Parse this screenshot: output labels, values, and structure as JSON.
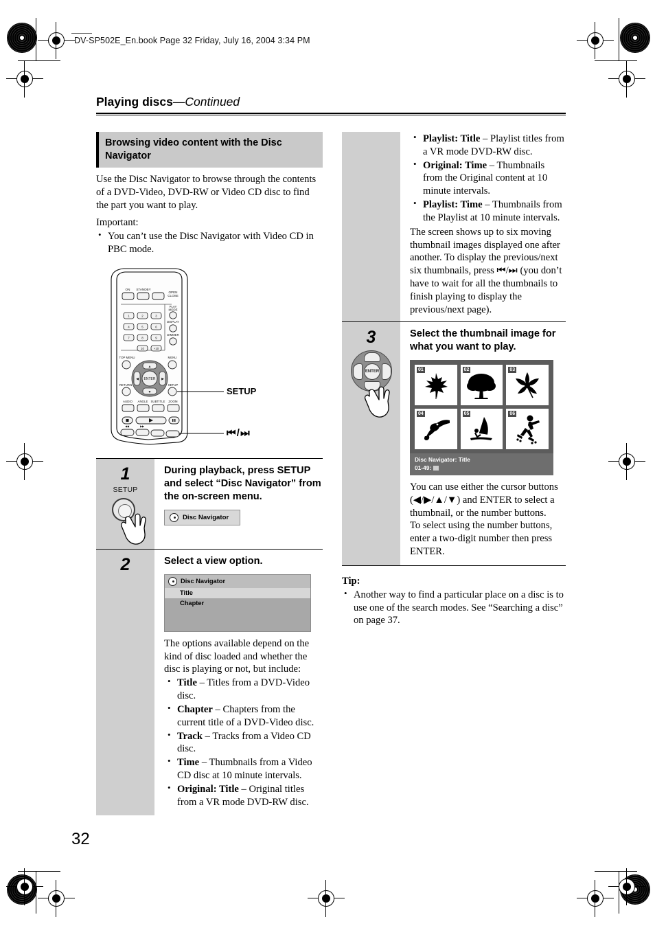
{
  "document": {
    "slug": "DV-SP502E_En.book  Page 32  Friday, July 16, 2004  3:34 PM",
    "running_head_main": "Playing discs",
    "running_head_cont": "—Continued",
    "page_number": "32"
  },
  "section": {
    "heading": "Browsing video content with the Disc Navigator",
    "intro": "Use the Disc Navigator to browse through the contents of a DVD-Video, DVD-RW or Video CD disc to find the part you want to play.",
    "important_label": "Important:",
    "important_bullets": [
      "You can’t use the Disc Navigator with Video CD in PBC mode."
    ]
  },
  "remote": {
    "callout_setup": "SETUP",
    "callout_skip": "⏮⏭",
    "buttons": {
      "on": "ON",
      "standby": "STANDBY",
      "open_close": "OPEN/CLOSE",
      "play_mode": "PLAY MODE",
      "display": "DISPLAY",
      "dimmer": "DIMMER",
      "top_menu": "TOP MENU",
      "menu": "MENU",
      "return": "RETURN",
      "setup": "SETUP",
      "audio": "AUDIO",
      "angle": "ANGLE",
      "subtitle": "SUBTITLE",
      "zoom": "ZOOM",
      "enter": "ENTER",
      "numbers": [
        "1",
        "2",
        "3",
        "4",
        "5",
        "6",
        "7",
        "8",
        "9",
        "10",
        "+10"
      ]
    }
  },
  "steps": [
    {
      "number": "1",
      "title": "During playback, press SETUP and select “Disc Navigator” from the on-screen menu.",
      "icon_label": "SETUP",
      "osd_chip": "Disc Navigator"
    },
    {
      "number": "2",
      "title": "Select a view option.",
      "panel": {
        "title": "Disc Navigator",
        "items": [
          {
            "label": "Title",
            "selected": true
          },
          {
            "label": "Chapter",
            "selected": false
          }
        ]
      },
      "body": "The options available depend on the kind of disc loaded and whether the disc is playing or not, but include:",
      "options": [
        {
          "term": "Title",
          "desc": " – Titles from a DVD-Video disc."
        },
        {
          "term": "Chapter",
          "desc": " – Chapters from the current title of a DVD-Video disc."
        },
        {
          "term": "Track",
          "desc": " – Tracks from a Video CD disc."
        },
        {
          "term": "Time",
          "desc": " – Thumbnails from a Video CD disc at 10 minute intervals."
        },
        {
          "term": "Original: Title",
          "desc": " – Original titles from a VR mode DVD-RW disc."
        },
        {
          "term": "Playlist: Title",
          "desc": " – Playlist titles from a VR mode DVD-RW disc."
        },
        {
          "term": "Original: Time",
          "desc": " – Thumbnails from the Original content at 10 minute intervals."
        },
        {
          "term": "Playlist: Time",
          "desc": " – Thumbnails from the Playlist at 10 minute intervals."
        }
      ],
      "after_options": "The screen shows up to six moving thumbnail images displayed one after another. To display the previous/next six thumbnails, press ⏮/⏭ (you don’t have to wait for all the thumbnails to finish playing to display the previous/next page)."
    },
    {
      "number": "3",
      "title": "Select the thumbnail image for what you want to play.",
      "thumbnails": [
        {
          "id": "01",
          "glyph": "☘"
        },
        {
          "id": "02",
          "glyph": "♣"
        },
        {
          "id": "03",
          "glyph": "❀"
        },
        {
          "id": "04",
          "glyph": "ὂ6"
        },
        {
          "id": "05",
          "glyph": "⛵"
        },
        {
          "id": "06",
          "glyph": "⛸"
        }
      ],
      "osd_caption_line1": "Disc Navigator: Title",
      "osd_caption_line2": "01-49:",
      "body1": "You can use either the cursor buttons (◀/▶/▲/▼) and ENTER to select a thumbnail, or the number buttons.",
      "body2": "To select using the number buttons, enter a two-digit number then press ENTER."
    }
  ],
  "tip": {
    "label": "Tip:",
    "bullets": [
      "Another way to find a particular place on a disc is to use one of the search modes. See “Searching a disc” on page 37."
    ]
  },
  "colors": {
    "heading_bar": "#c9c9c9",
    "step_column": "#cfcfcf",
    "osd_panel": "#a8a8a8",
    "osd_dark": "#5c5c5c"
  }
}
